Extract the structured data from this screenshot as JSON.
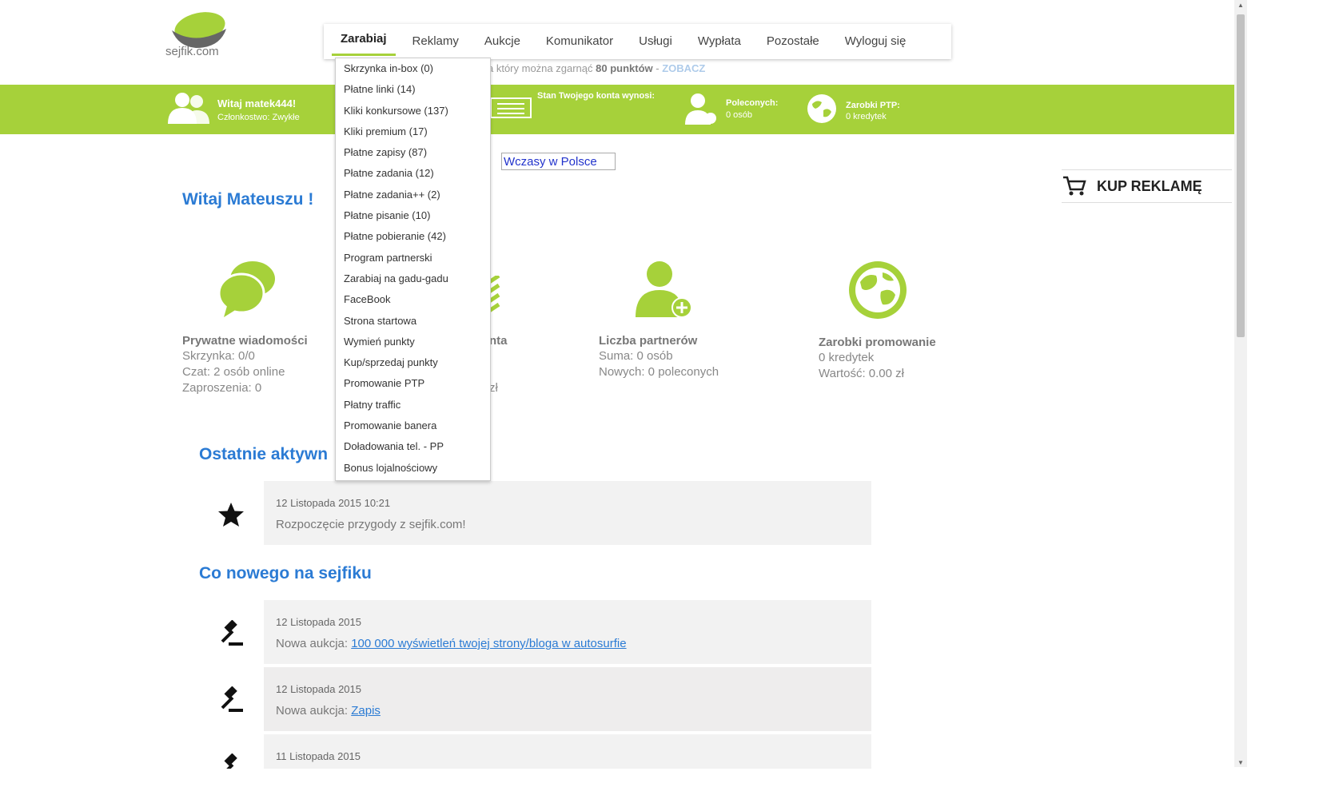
{
  "logo": {
    "text": "sejfik.com"
  },
  "nav": {
    "items": [
      "Zarabiaj",
      "Reklamy",
      "Aukcje",
      "Komunikator",
      "Usługi",
      "Wypłata",
      "Pozostałe",
      "Wyloguj się"
    ]
  },
  "subbar": {
    "prefix": "a który można zgarnąć",
    "points": "80 punktów",
    "sep": " - ",
    "link": "ZOBACZ"
  },
  "dropdown": {
    "items": [
      "Skrzynka in-box (0)",
      "Płatne linki (14)",
      "Kliki konkursowe (137)",
      "Kliki premium (17)",
      "Płatne zapisy (87)",
      "Płatne zadania (12)",
      "Płatne zadania++ (2)",
      "Płatne pisanie (10)",
      "Płatne pobieranie (42)",
      "Program partnerski",
      "Zarabiaj na gadu-gadu",
      "FaceBook",
      "Strona startowa",
      "Wymień punkty",
      "Kup/sprzedaj punkty",
      "Promowanie PTP",
      "Płatny traffic",
      "Promowanie banera",
      "Doładowania tel. - PP",
      "Bonus lojalnościowy"
    ]
  },
  "greenbar": {
    "user_title": "Witaj matek444!",
    "user_sub": "Członkostwo: Zwykłe",
    "balance_title": "Stan Twojego konta wynosi:",
    "refs_title": "Poleconych:",
    "refs_sub": "0 osób",
    "ptp_title": "Zarobki PTP:",
    "ptp_sub": "0 kredytek"
  },
  "banner_alt": "Wczasy w Polsce",
  "buy_label": "KUP REKLAMĘ",
  "hello": "Witaj Mateuszu !",
  "stats": {
    "messages": {
      "title": "Prywatne wiadomości",
      "lines": [
        "Skrzynka: 0/0",
        "Czat: 2 osób online",
        "Zaproszenia: 0"
      ]
    },
    "account": {
      "title_tail": "nta",
      "line_tail": "zł"
    },
    "partners": {
      "title": "Liczba partnerów",
      "lines": [
        "Suma: 0 osób",
        "Nowych: 0 poleconych"
      ]
    },
    "promo": {
      "title": "Zarobki promowanie",
      "lines": [
        "0 kredytek",
        "Wartość: 0.00 zł"
      ]
    }
  },
  "recent": {
    "heading": "Ostatnie aktywn",
    "items": [
      {
        "date": "12 Listopada 2015 10:21",
        "text": "Rozpoczęcie przygody z sejfik.com!"
      }
    ]
  },
  "news": {
    "heading": "Co nowego na sejfiku",
    "items": [
      {
        "date": "12 Listopada 2015",
        "prefix": "Nowa aukcja: ",
        "link": "100 000 wyświetleń twojej strony/bloga w autosurfie"
      },
      {
        "date": "12 Listopada 2015",
        "prefix": "Nowa aukcja: ",
        "link": "Zapis"
      },
      {
        "date": "11 Listopada 2015",
        "prefix": "",
        "link": ""
      }
    ]
  },
  "colors": {
    "green": "#a6d13a",
    "blue": "#2b7bd4"
  }
}
